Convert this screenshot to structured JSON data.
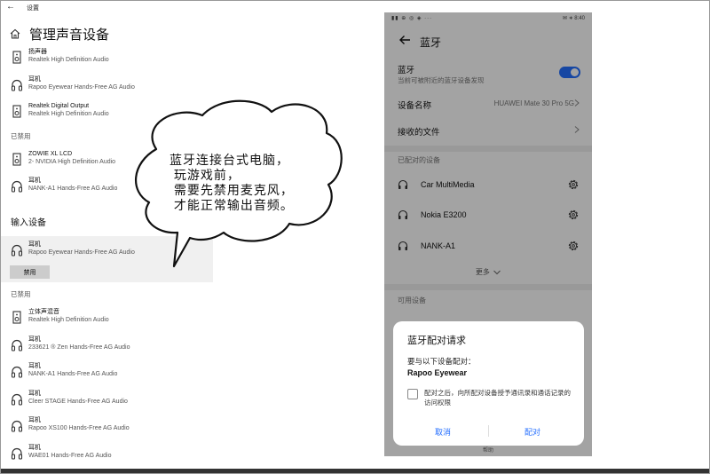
{
  "win": {
    "back_glyph": "←",
    "titlebar": "设置",
    "page_title": "管理声音设备",
    "devices_top": [
      {
        "name": "扬声器",
        "sub": "Realtek High Definition Audio",
        "icon": "speaker-icon"
      },
      {
        "name": "耳机",
        "sub": "Rapoo Eyewear Hands-Free AG Audio",
        "icon": "headphones-icon"
      },
      {
        "name": "Realtek Digital Output",
        "sub": "Realtek High Definition Audio",
        "icon": "speaker-icon"
      }
    ],
    "disabled_label_1": "已禁用",
    "devices_disabled_1": [
      {
        "name": "ZOWIE XL LCD",
        "sub": "2- NVIDIA High Definition Audio",
        "icon": "speaker-icon"
      },
      {
        "name": "耳机",
        "sub": "NANK-A1 Hands-Free AG Audio",
        "icon": "headphones-icon"
      }
    ],
    "input_heading": "输入设备",
    "input_device": {
      "name": "耳机",
      "sub": "Rapoo Eyewear Hands-Free AG Audio",
      "icon": "headphones-icon"
    },
    "disable_button": "禁用",
    "disabled_label_2": "已禁用",
    "devices_disabled_2": [
      {
        "name": "立体声混音",
        "sub": "Realtek High Definition Audio",
        "icon": "speaker-icon"
      },
      {
        "name": "耳机",
        "sub": "233621 ® Zen Hands-Free AG Audio",
        "icon": "headphones-icon"
      },
      {
        "name": "耳机",
        "sub": "NANK-A1 Hands-Free AG Audio",
        "icon": "headphones-icon"
      },
      {
        "name": "耳机",
        "sub": "Cleer STAGE Hands-Free AG Audio",
        "icon": "headphones-icon"
      },
      {
        "name": "耳机",
        "sub": "Rapoo XS100 Hands-Free AG Audio",
        "icon": "headphones-icon"
      },
      {
        "name": "耳机",
        "sub": "WAE01 Hands-Free AG Audio",
        "icon": "headphones-icon"
      }
    ]
  },
  "bubble": {
    "text": "蓝牙连接台式电脑，\n 玩游戏前，\n 需要先禁用麦克风，\n 才能正常输出音频。"
  },
  "phone": {
    "status_left": "▮▮ ⊕ ◎ ◈ ···",
    "status_right": "✉ ∗ 8:40",
    "title": "蓝牙",
    "bt_label": "蓝牙",
    "bt_sub": "当前可被附近的蓝牙设备发现",
    "bt_enabled": true,
    "device_name_label": "设备名称",
    "device_name_value": "HUAWEI Mate 30 Pro 5G",
    "received_files": "接收的文件",
    "paired_section": "已配对的设备",
    "paired": [
      {
        "name": "Car MultiMedia",
        "icon": "headset-icon"
      },
      {
        "name": "Nokia E3200",
        "icon": "headset-icon"
      },
      {
        "name": "NANK-A1",
        "icon": "headset-icon"
      }
    ],
    "more": "更多",
    "available_section": "可用设备",
    "bottom_text": "帮助",
    "dialog": {
      "title": "蓝牙配对请求",
      "text": "要与以下设备配对：",
      "device": "Rapoo Eyewear",
      "note": "配对之后，向所配对设备授予通讯录和通话记录的访问权限",
      "checked": false,
      "cancel": "取消",
      "pair": "配对"
    },
    "colors": {
      "accent": "#256fff"
    }
  }
}
